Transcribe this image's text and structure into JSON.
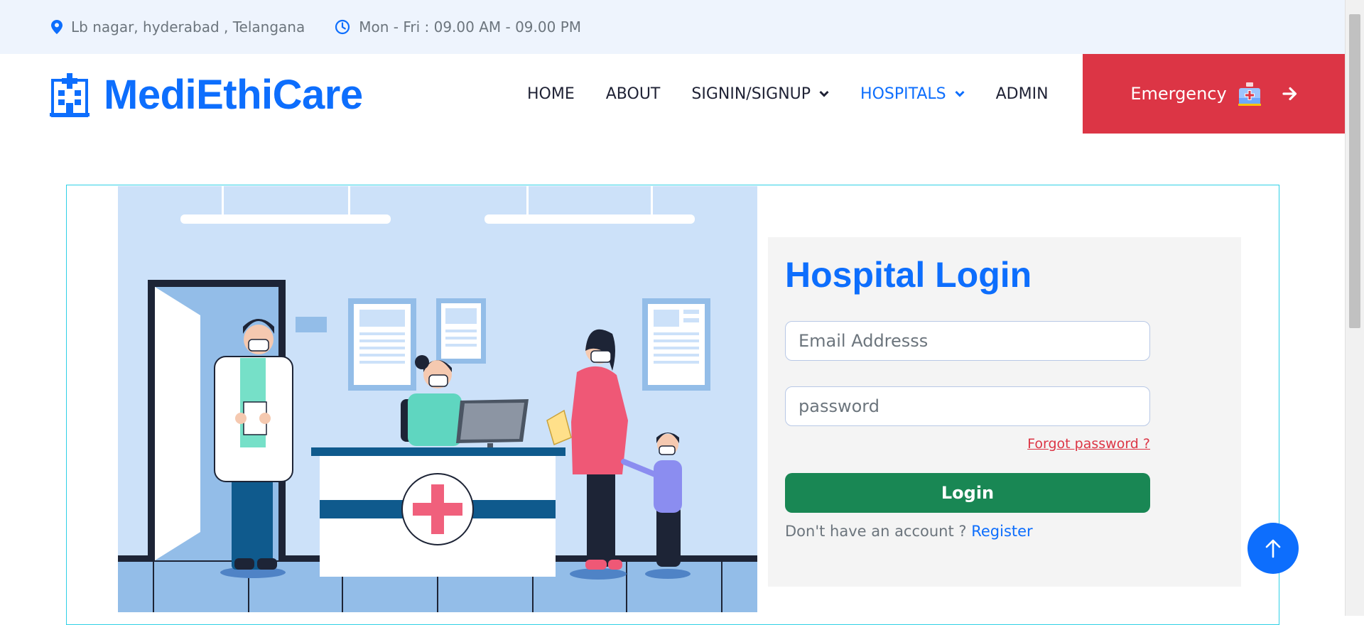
{
  "topbar": {
    "address": "Lb nagar, hyderabad , Telangana",
    "hours": "Mon - Fri : 09.00 AM - 09.00 PM",
    "icons": [
      "map-pin-icon",
      "clock-icon"
    ]
  },
  "brand": {
    "name": "MediEthiCare",
    "icon": "hospital-building-icon"
  },
  "nav": {
    "home": "HOME",
    "about": "ABOUT",
    "signin": "SIGNIN/SIGNUP",
    "hospitals": "HOSPITALS",
    "admin": "ADMIN",
    "active": "HOSPITALS"
  },
  "emergency": {
    "label": "Emergency",
    "icon": "ambulance-icon",
    "arrow": "arrow-right-icon"
  },
  "login": {
    "title": "Hospital Login",
    "email_placeholder": "Email Addresss",
    "password_placeholder": "password",
    "forgot": "Forgot password ?",
    "button": "Login",
    "no_account": "Don't have an account ? ",
    "register": "Register"
  },
  "colors": {
    "primary": "#0d6efd",
    "danger": "#dc3545",
    "success": "#198754",
    "topbar_bg": "#eef4fd",
    "panel_bg": "#f4f4f4"
  }
}
